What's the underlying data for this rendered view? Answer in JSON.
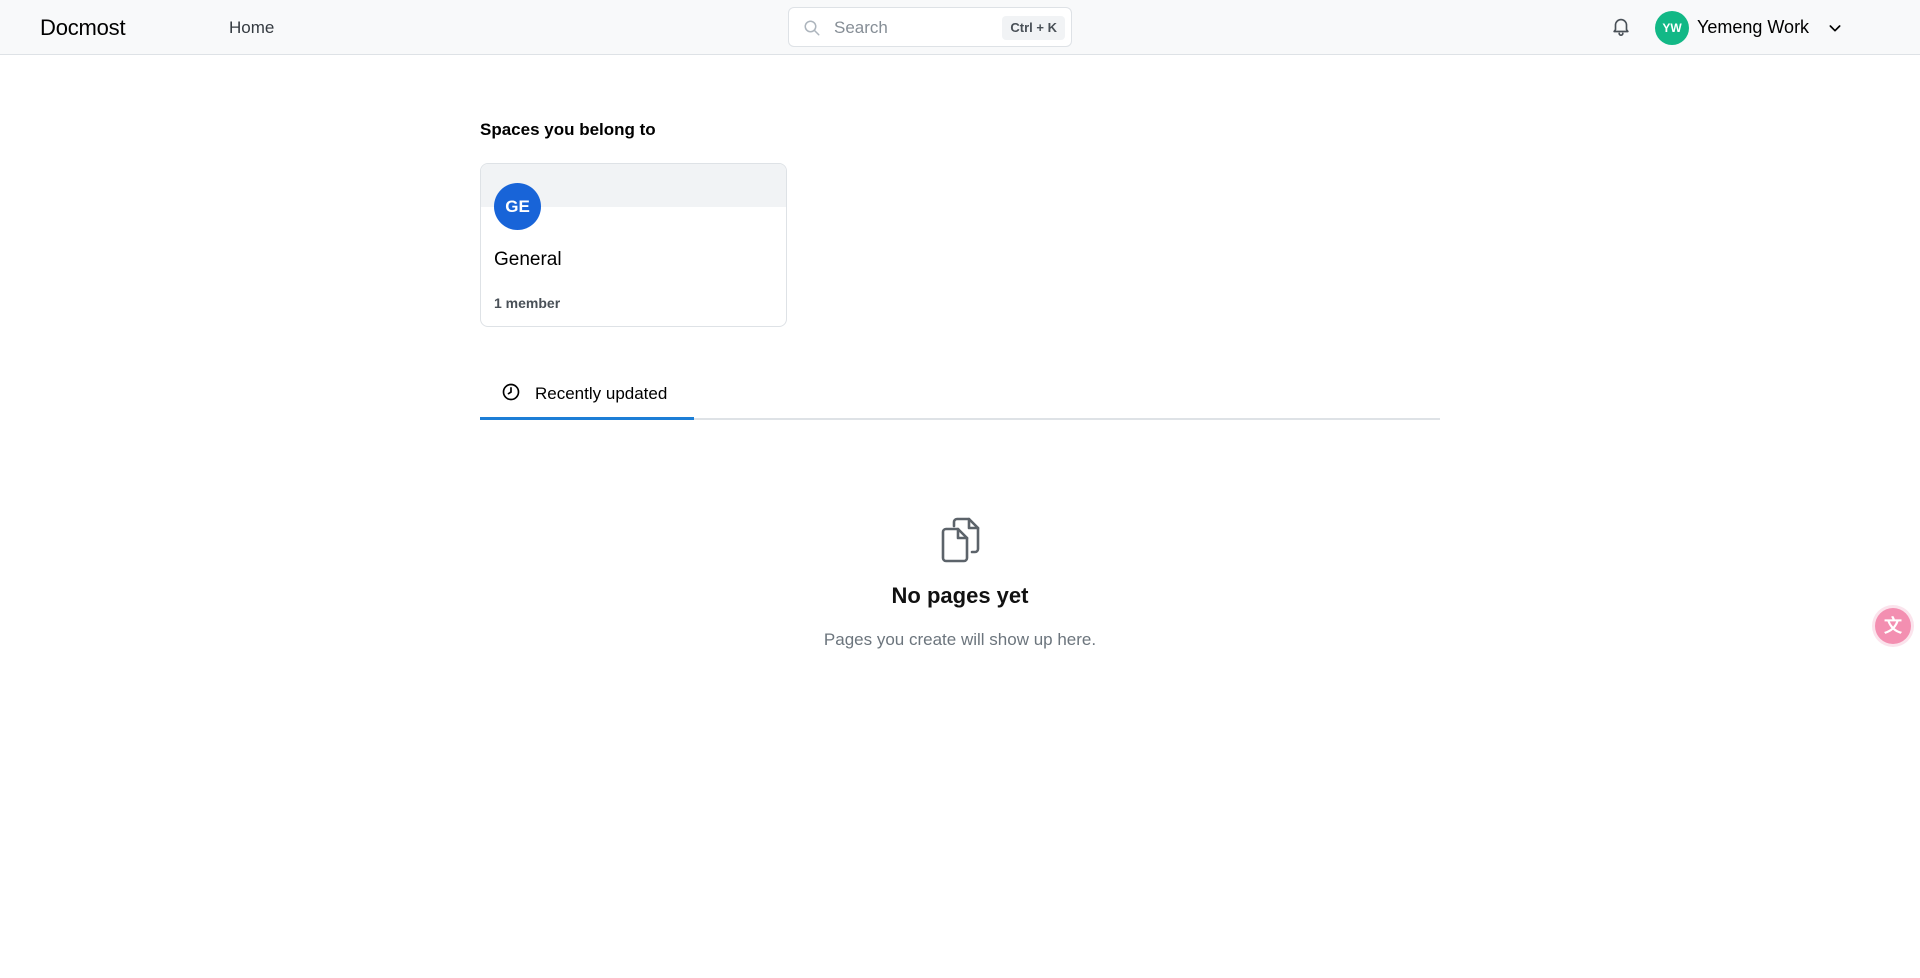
{
  "header": {
    "logo": "Docmost",
    "nav_home": "Home",
    "search": {
      "placeholder": "Search",
      "shortcut": "Ctrl + K"
    },
    "user": {
      "initials": "YW",
      "name": "Yemeng Work"
    }
  },
  "spaces": {
    "title": "Spaces you belong to",
    "items": [
      {
        "initials": "GE",
        "name": "General",
        "members": "1 member"
      }
    ]
  },
  "tabs": [
    {
      "label": "Recently updated",
      "icon": "clock-icon"
    }
  ],
  "empty_state": {
    "title": "No pages yet",
    "subtitle": "Pages you create will show up here.",
    "icon": "copy-pages-icon"
  },
  "colors": {
    "accent": "#1c7ed6",
    "space_avatar": "#1864d8",
    "user_avatar": "#12b886",
    "translate_button": "#f38fb1"
  }
}
